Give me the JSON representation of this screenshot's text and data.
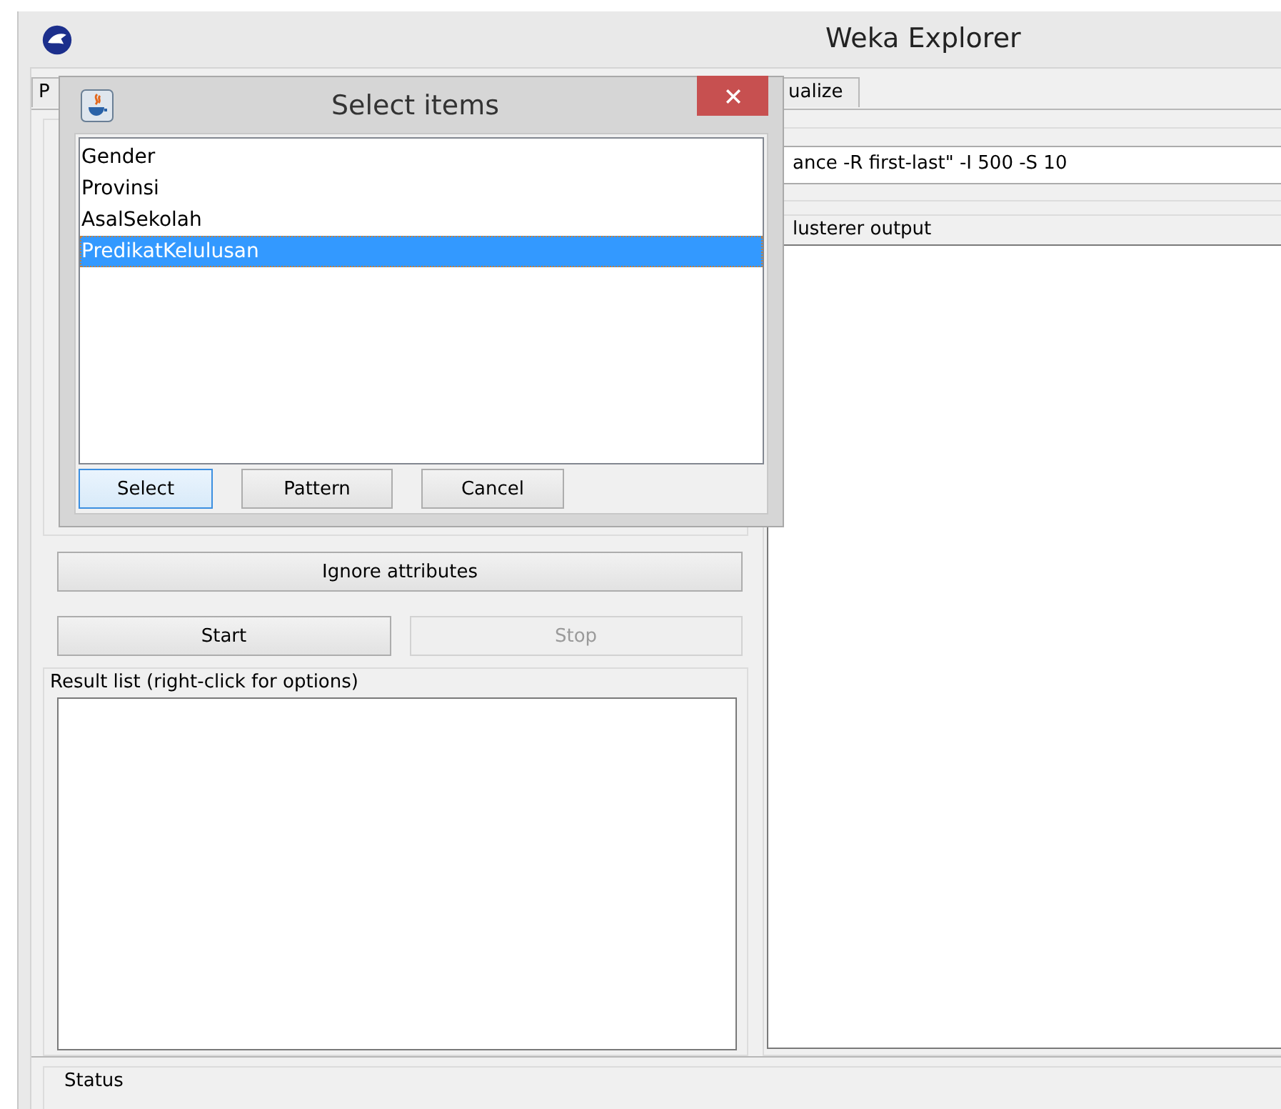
{
  "window": {
    "title": "Weka Explorer"
  },
  "tabs": [
    {
      "label": "P",
      "selected": false
    },
    {
      "label": "ualize",
      "selected": false
    }
  ],
  "clusterer_field": {
    "value": "ance -R first-last\" -I 500 -S 10"
  },
  "buttons": [
    {
      "label": "Ignore attributes",
      "disabled": false,
      "kind": "wide"
    },
    {
      "label": "Start",
      "disabled": false,
      "kind": "half"
    },
    {
      "label": "Stop",
      "disabled": true,
      "kind": "half"
    }
  ],
  "result_list": {
    "title": "Result list (right-click for options)"
  },
  "output": {
    "title": "lusterer output"
  },
  "status": {
    "title": "Status"
  },
  "dialog": {
    "title": "Select items",
    "items": [
      {
        "label": "Gender",
        "selected": false
      },
      {
        "label": "Provinsi",
        "selected": false
      },
      {
        "label": "AsalSekolah",
        "selected": false
      },
      {
        "label": "PredikatKelulusan",
        "selected": true
      }
    ],
    "buttons": [
      {
        "label": "Select",
        "focused": true
      },
      {
        "label": "Pattern",
        "focused": false
      },
      {
        "label": "Cancel",
        "focused": false
      }
    ]
  }
}
